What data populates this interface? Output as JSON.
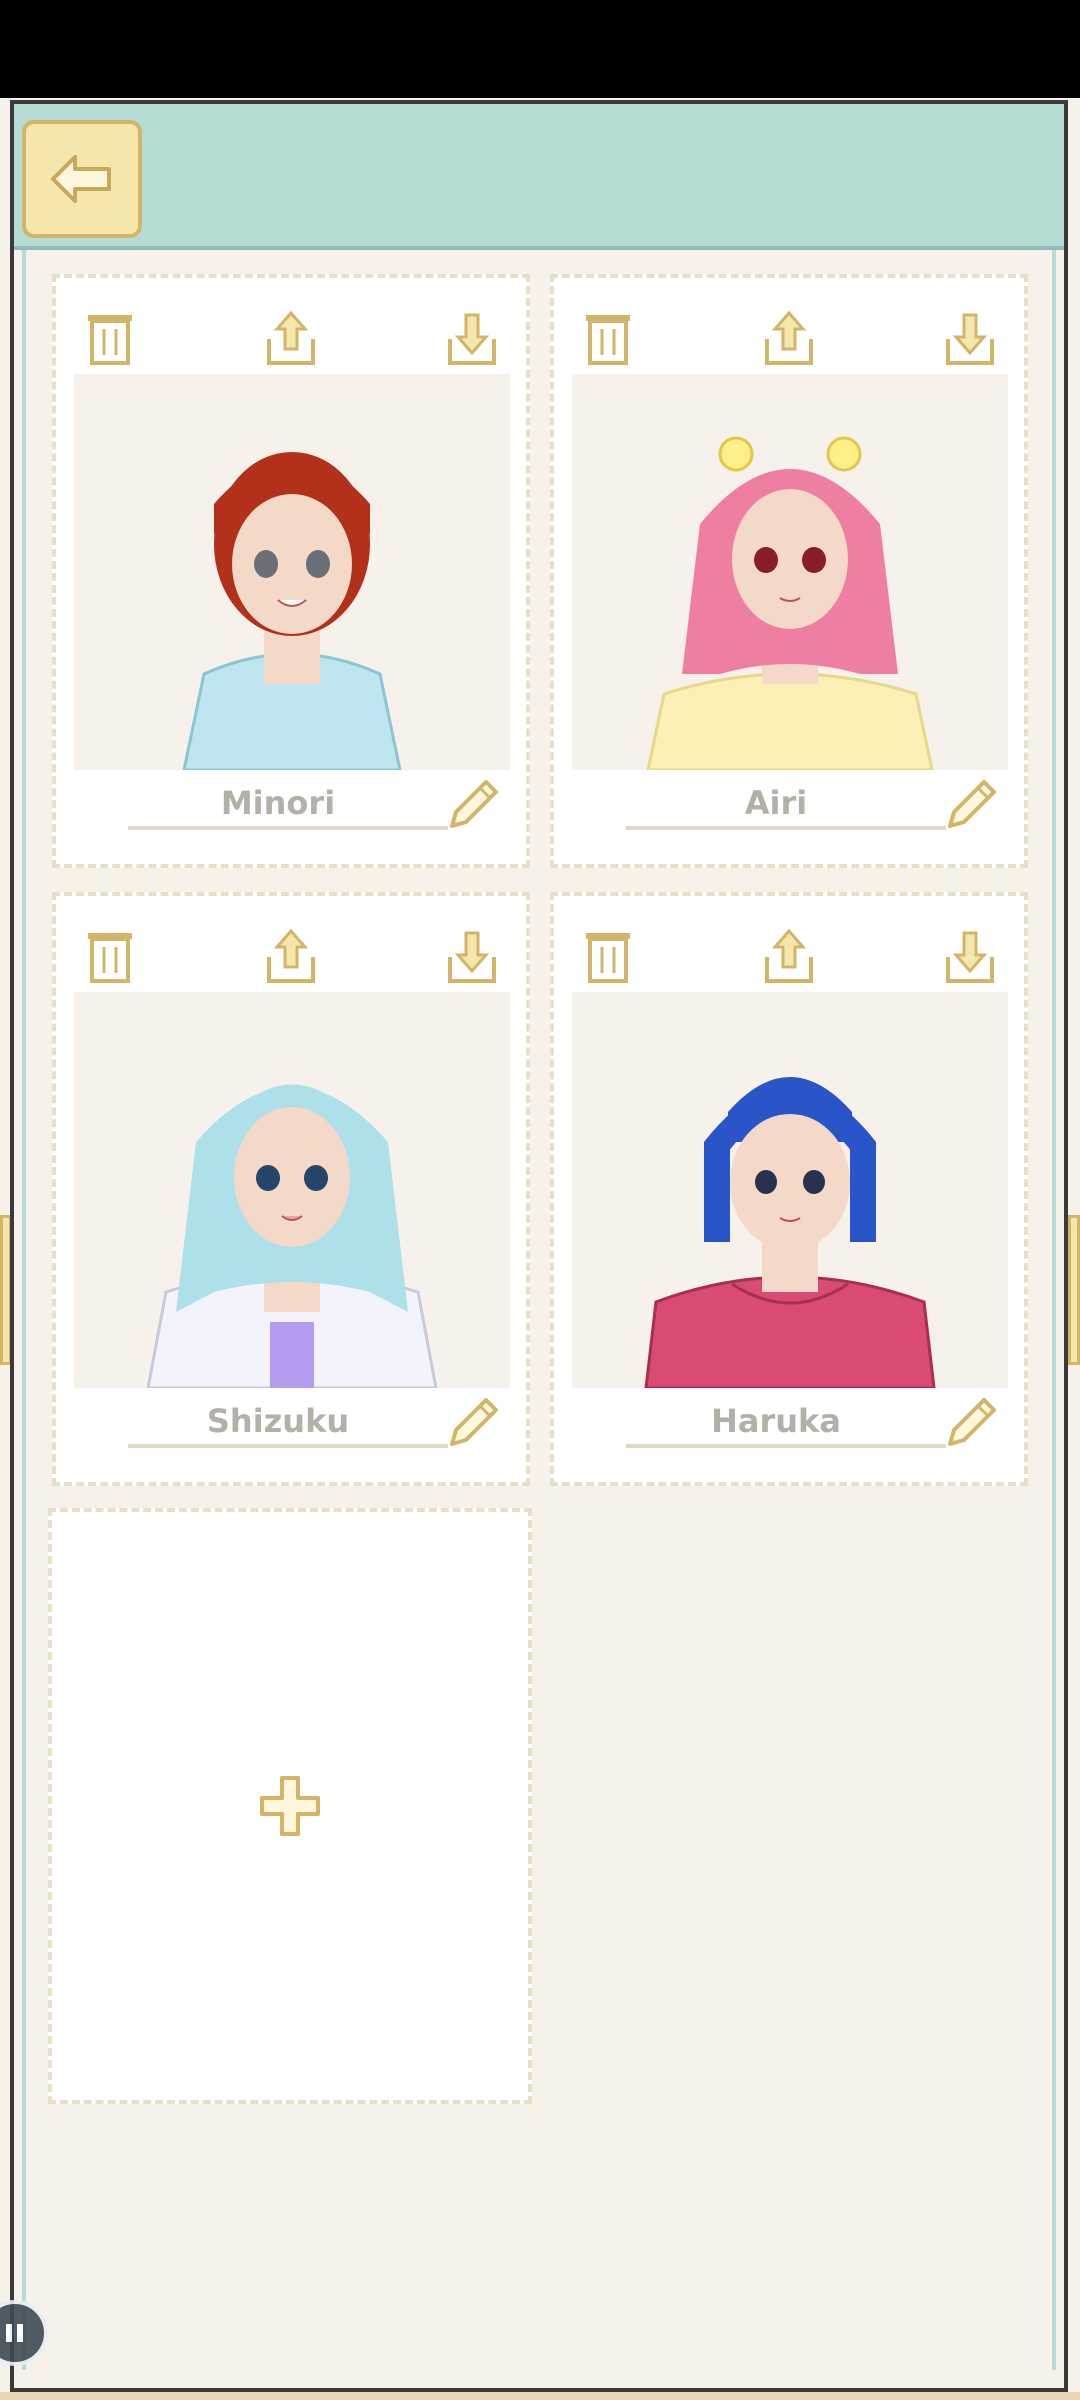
{
  "header": {
    "back_icon": "arrow-left-icon"
  },
  "characters": [
    {
      "name": "Minori",
      "hair": "#b3301a",
      "skin": "#f4d8c8",
      "clothes": "#bfe6f0"
    },
    {
      "name": "Airi",
      "hair": "#ef7fa0",
      "skin": "#f4d8c8",
      "clothes": "#fdf0b6"
    },
    {
      "name": "Shizuku",
      "hair": "#aee0ea",
      "skin": "#f4d8c8",
      "clothes": "#f3f3fb"
    },
    {
      "name": "Haruka",
      "hair": "#2a55c8",
      "skin": "#f4d8c8",
      "clothes": "#d94b72"
    }
  ],
  "card_icons": [
    "trash-icon",
    "upload-icon",
    "download-icon"
  ],
  "edit_icon": "pencil-icon",
  "add_icon": "plus-icon",
  "colors": {
    "header": "#b6dcd6",
    "accent": "#d2b567",
    "background": "#f6f2ea"
  }
}
